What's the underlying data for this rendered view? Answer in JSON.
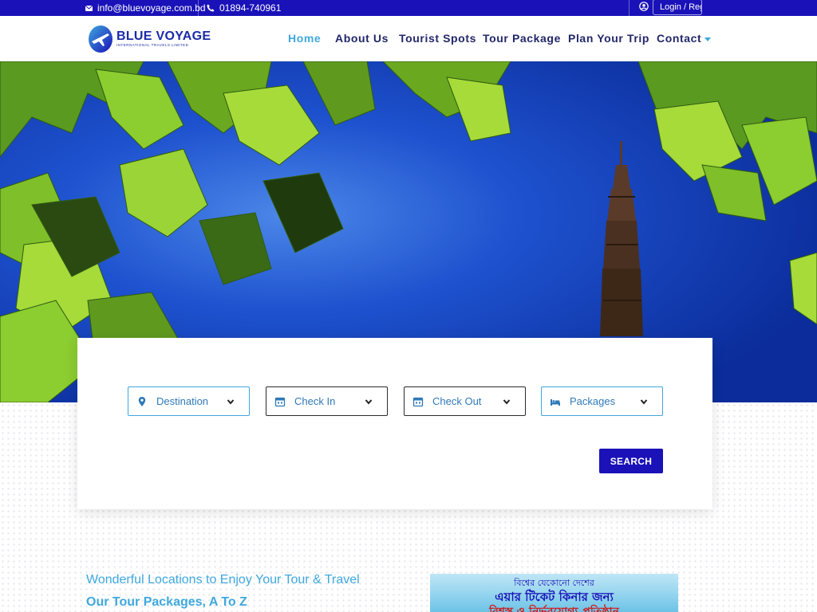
{
  "topbar": {
    "email": "info@bluevoyage.com.bd",
    "phone": "01894-740961",
    "login_label": "Login / Register"
  },
  "brand": {
    "name": "BLUE VOYAGE",
    "subtitle": "INTERNATIONAL TRAVELS LIMITED"
  },
  "nav": {
    "items": [
      "Home",
      "About Us",
      "Tourist Spots",
      "Tour Package",
      "Plan Your Trip",
      "Contact"
    ],
    "active": "Home"
  },
  "search": {
    "fields": [
      {
        "label": "Destination",
        "icon": "map-pin-icon"
      },
      {
        "label": "Check In",
        "icon": "calendar-icon"
      },
      {
        "label": "Check Out",
        "icon": "calendar-icon"
      },
      {
        "label": "Packages",
        "icon": "bed-icon"
      }
    ],
    "button_label": "SEARCH"
  },
  "section": {
    "tagline": "Wonderful Locations to Enjoy Your Tour & Travel",
    "title": "Our Tour Packages, A To Z"
  },
  "promo": {
    "line1": "বিশ্বের যেকোনো দেশের",
    "line2": "এয়ার টিকেট কিনার জন্য",
    "line3": "বিশ্বস্ত ও নির্ভরযোগ্য প্রতিষ্ঠান"
  },
  "colors": {
    "primary": "#1a12b8",
    "accent": "#3ea8de",
    "nav_text": "#23276a"
  }
}
